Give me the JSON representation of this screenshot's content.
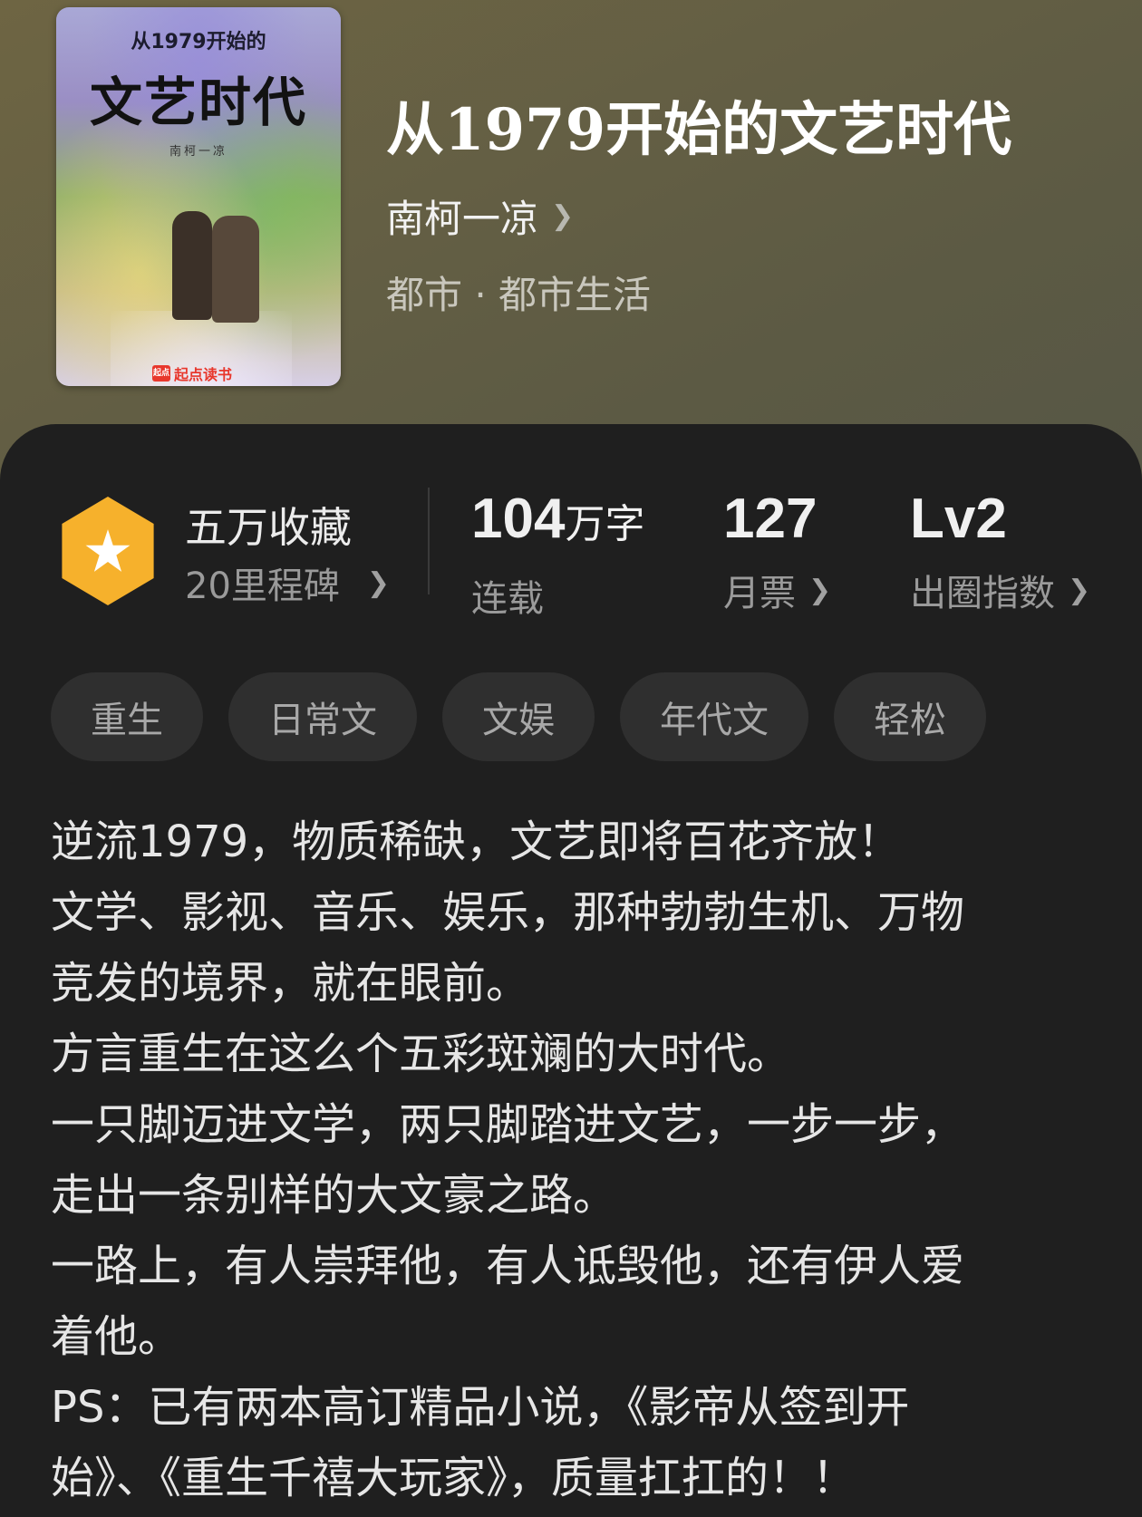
{
  "cover": {
    "small_title": "从1979开始的",
    "title": "文艺时代",
    "author": "南柯一凉",
    "publisher_mark": "起点",
    "publisher": "起点读书"
  },
  "book": {
    "title": "从1979开始的文艺时代",
    "author": "南柯一凉",
    "genre": "都市 · 都市生活"
  },
  "badge": {
    "title": "五万收藏",
    "subtitle": "20里程碑",
    "icon": "star-hexagon-icon",
    "color": "#f6b12c"
  },
  "stats": [
    {
      "value": "104",
      "unit": "万字",
      "label": "连载"
    },
    {
      "value": "127",
      "unit": "",
      "label": "月票"
    },
    {
      "value": "Lv2",
      "unit": "",
      "label": "出圈指数"
    }
  ],
  "tags": [
    "重生",
    "日常文",
    "文娱",
    "年代文",
    "轻松"
  ],
  "synopsis": [
    "逆流1979，物质稀缺，文艺即将百花齐放！",
    "文学、影视、音乐、娱乐，那种勃勃生机、万物",
    "竞发的境界，就在眼前。",
    "方言重生在这么个五彩斑斓的大时代。",
    "一只脚迈进文学，两只脚踏进文艺，一步一步，",
    "走出一条别样的大文豪之路。",
    "一路上，有人崇拜他，有人诋毁他，还有伊人爱",
    "着他。",
    "PS：已有两本高订精品小说，《影帝从签到开",
    "始》、《重生千禧大玩家》，质量扛扛的！！"
  ]
}
